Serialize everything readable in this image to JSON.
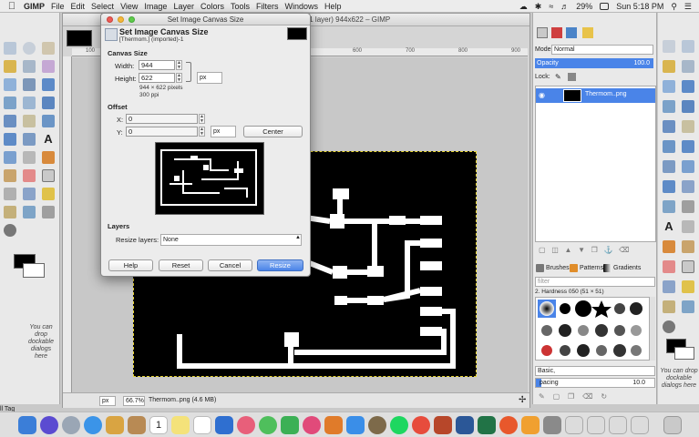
{
  "menubar": {
    "app_name": "GIMP",
    "items": [
      "File",
      "Edit",
      "Select",
      "View",
      "Image",
      "Layer",
      "Colors",
      "Tools",
      "Filters",
      "Windows",
      "Help"
    ],
    "battery": "29%",
    "clock": "Sun 5:18 PM"
  },
  "image_window": {
    "title": "-1.0 (indexed color, 1 layer) 944x622 – GIMP",
    "ruler_marks": [
      "100",
      "500",
      "600",
      "700",
      "800",
      "900"
    ],
    "status": {
      "unit": "px",
      "zoom": "66.7%",
      "file_info": "Thermom..png (4.6 MB)"
    }
  },
  "toolbox": {
    "drop_hint": "You can drop dockable dialogs here",
    "bottom_label": "ll Tag"
  },
  "dialog": {
    "window_title": "Set Image Canvas Size",
    "heading": "Set Image Canvas Size",
    "subheading": "[Thermom.] (imported)-1",
    "canvas_size": {
      "section": "Canvas Size",
      "width_label": "Width:",
      "width_value": "944",
      "height_label": "Height:",
      "height_value": "622",
      "unit": "px",
      "info_pixels": "944 × 622 pixels",
      "info_ppi": "300 ppi"
    },
    "offset": {
      "section": "Offset",
      "x_label": "X:",
      "x_value": "0",
      "y_label": "Y:",
      "y_value": "0",
      "unit": "px",
      "center_label": "Center"
    },
    "layers": {
      "section": "Layers",
      "resize_label": "Resize layers:",
      "resize_value": "None"
    },
    "buttons": {
      "help": "Help",
      "reset": "Reset",
      "cancel": "Cancel",
      "resize": "Resize"
    }
  },
  "layers_dock": {
    "mode_label": "Mode:",
    "mode_value": "Normal",
    "opacity_label": "Opacity",
    "opacity_value": "100.0",
    "lock_label": "Lock:",
    "layer_name": "Thermom..png"
  },
  "brushes_dock": {
    "tabs": [
      "Brushes",
      "Patterns",
      "Gradients"
    ],
    "filter_placeholder": "filter",
    "brush_name": "2. Hardness 050 (51 × 51)",
    "preset": "Basic,",
    "spacing_label": "pacing",
    "spacing_value": "10.0"
  },
  "right_dock": {
    "drop_hint": "You can drop dockable dialogs here"
  },
  "colors": {
    "accent": "#4a84e8",
    "selection": "#e5d330",
    "canvas": "#000000"
  }
}
